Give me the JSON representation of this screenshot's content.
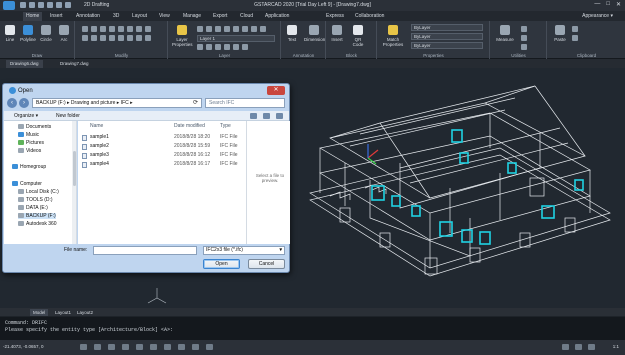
{
  "titlebar": {
    "workspace": "2D Drafting",
    "title": "GSTARCAD 2020 [Trial Day Left 9] - [Drawing7.dwg]",
    "window_controls": [
      "—",
      "□",
      "✕"
    ]
  },
  "menu": {
    "items": [
      "Home",
      "Insert",
      "Annotation",
      "3D",
      "Layout",
      "View",
      "Manage",
      "Export",
      "Cloud",
      "Application",
      "Express",
      "Collaboration"
    ],
    "appearance": "Appearance ▾"
  },
  "ribbon": {
    "draw": {
      "label": "Draw",
      "tools": [
        "Line",
        "Polyline",
        "Circle",
        "Arc"
      ]
    },
    "modify": {
      "label": "Modify"
    },
    "layer": {
      "label": "Layer",
      "properties_label": "Layer Properties",
      "current_layer": "Layer 1"
    },
    "annotation": {
      "label": "Annotation",
      "tools": [
        "Text",
        "Dimension"
      ]
    },
    "block": {
      "label": "Block",
      "tools": [
        "Insert",
        "QR Code"
      ]
    },
    "properties": {
      "label": "Properties",
      "match_label": "Match Properties",
      "bylayer": [
        "ByLayer",
        "ByLayer",
        "ByLayer"
      ]
    },
    "utilities": {
      "label": "Utilities",
      "tools": [
        "Measure"
      ]
    },
    "clipboard": {
      "label": "Clipboard",
      "tools": [
        "Paste"
      ]
    }
  },
  "doc_tabs": [
    "Drawing6.dwg",
    "Drawing7.dwg"
  ],
  "layout_tabs": [
    "Model",
    "Layout1",
    "Layout2"
  ],
  "command_line": [
    "Command:  DRIFC",
    "Please specify the entity type [Architecture/Block] <A>:"
  ],
  "status": {
    "coords": "-21.4073, -0.0657, 0",
    "zoom": "1:1"
  },
  "dialog": {
    "title": "Open",
    "address": "BACKUP (F:)  ▸  Drawing and picture  ▸  IFC  ▸",
    "search_placeholder": "Search IFC",
    "toolbar": {
      "organize": "Organize ▾",
      "new_folder": "New folder"
    },
    "nav_items": [
      "Documents",
      "Music",
      "Pictures",
      "Videos",
      "Homegroup",
      "Computer",
      "Local Disk (C:)",
      "TOOLS (D:)",
      "DATA (E:)",
      "BACKUP (F:)",
      "Autodesk 360"
    ],
    "columns": {
      "name": "Name",
      "date": "Date modified",
      "type": "Type"
    },
    "files": [
      {
        "name": "sample1",
        "date": "2018/8/28 18:20",
        "type": "IFC File"
      },
      {
        "name": "sample2",
        "date": "2018/8/28 15:59",
        "type": "IFC File"
      },
      {
        "name": "sample3",
        "date": "2018/8/28 16:12",
        "type": "IFC File"
      },
      {
        "name": "sample4",
        "date": "2018/8/28 16:17",
        "type": "IFC File"
      }
    ],
    "preview_text": "Select a file to preview.",
    "file_name_label": "File name:",
    "file_name_value": "",
    "file_type": "IFC2x3 file (*.ifc)",
    "open_label": "Open",
    "cancel_label": "Cancel"
  }
}
